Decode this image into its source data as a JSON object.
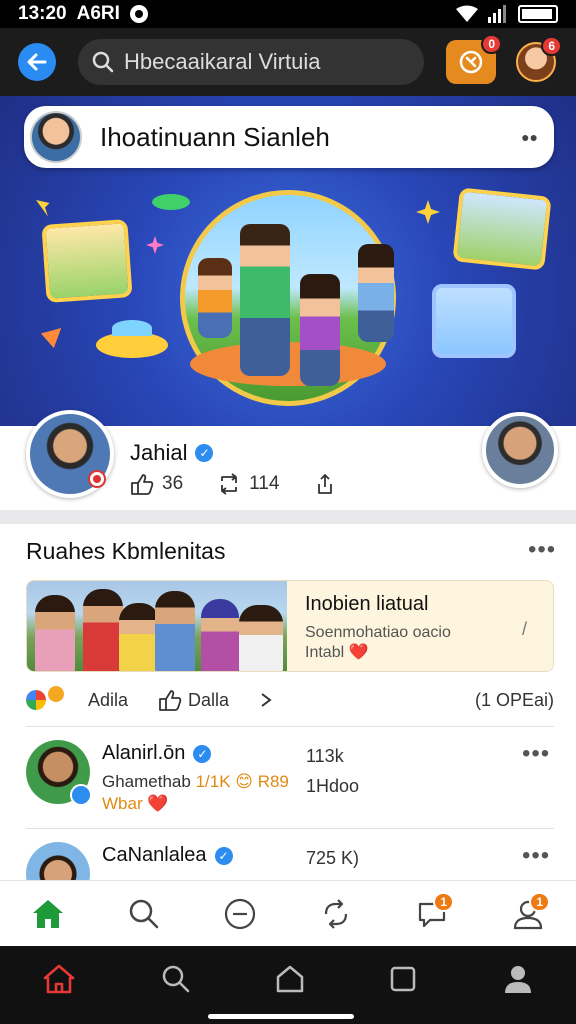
{
  "status_bar": {
    "time": "13:20",
    "network": "A6RI"
  },
  "top_bar": {
    "search_text": "Hbecaaikaral Virtuia",
    "reel_badge": "0",
    "avatar_badge": "6"
  },
  "hero": {
    "title": "Ihoatinuann Sianleh"
  },
  "profile": {
    "name": "Jahial",
    "likes": "36",
    "reposts": "114"
  },
  "community": {
    "title": "Ruahes Kbmlenitas",
    "featured": {
      "title": "Inobien liatual",
      "subtitle": "Soenmohatiao oacio",
      "subtitle2": "Intabl ❤️"
    },
    "actions": {
      "action1": "Adila",
      "action2": "Dalla",
      "count": "(1 OPEai)"
    },
    "comments": [
      {
        "name": "Alanirl.ōn",
        "line1_prefix": "Ghamethab ",
        "line1_highlight": "1/1K 😊 R89",
        "line2": "Wbar ❤️",
        "count": "113k",
        "sub": "1Hdoo"
      },
      {
        "name": "CaNanlalea",
        "count": "725 K)"
      }
    ]
  },
  "app_nav": {
    "comment_badge": "1",
    "profile_badge": "1"
  },
  "colors": {
    "accent_blue": "#2a8bf2",
    "orange": "#e58a1e",
    "home_green": "#1f9a3a",
    "sys_home_red": "#e53935"
  },
  "icons": [
    "back-arrow-icon",
    "search-icon",
    "reel-icon",
    "heart-icon",
    "repost-icon",
    "share-icon",
    "more-icon",
    "home-icon",
    "plus-circle-icon",
    "refresh-icon",
    "chat-icon",
    "profile-icon"
  ]
}
